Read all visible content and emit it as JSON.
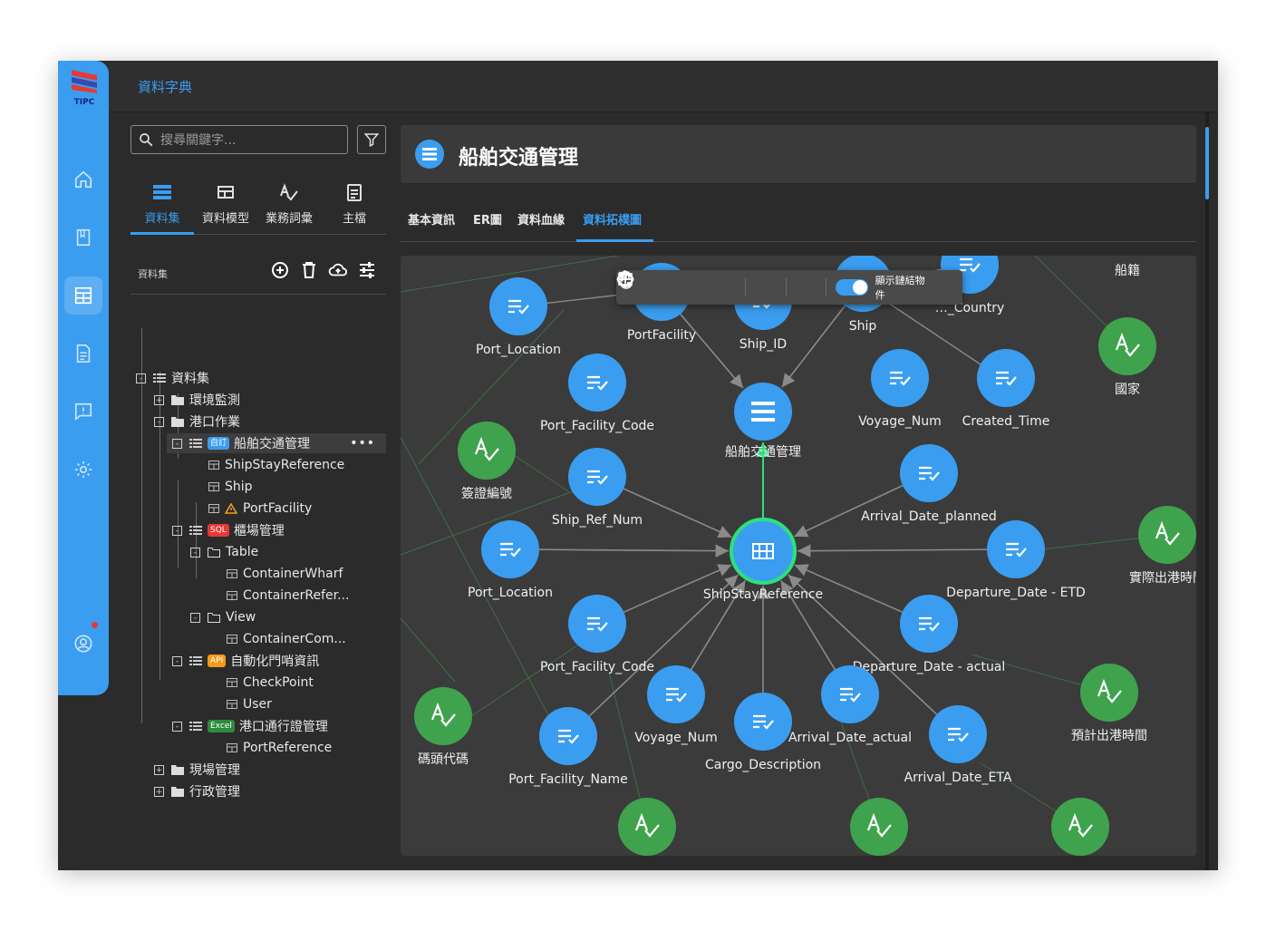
{
  "app": {
    "title": "資料字典",
    "logo_text": "TIPC",
    "brand_color": "#3a9df0"
  },
  "rail": {
    "items": [
      "home-icon",
      "book-icon",
      "dashboard-icon",
      "document-icon",
      "feedback-icon",
      "settings-icon"
    ],
    "user_icon": "user-icon"
  },
  "search": {
    "placeholder": "搜尋關鍵字..."
  },
  "left_tabs": [
    {
      "label": "資料集"
    },
    {
      "label": "資料模型"
    },
    {
      "label": "業務詞彙"
    },
    {
      "label": "主檔"
    }
  ],
  "section": {
    "label": "資料集"
  },
  "tree": {
    "root": "資料集",
    "env": "環境監測",
    "port": "港口作業",
    "ship_traffic": {
      "badge": "自訂",
      "label": "船舶交通管理",
      "more": "•••"
    },
    "ship_stay": "ShipStayReference",
    "ship": "Ship",
    "port_facility": "PortFacility",
    "yard": {
      "badge": "SQL",
      "label": "櫃場管理"
    },
    "table": "Table",
    "container_wharf": "ContainerWharf",
    "container_refer": "ContainerRefer...",
    "view": "View",
    "container_com": "ContainerCom...",
    "gate": {
      "badge": "API",
      "label": "自動化門哨資訊"
    },
    "checkpoint": "CheckPoint",
    "user": "User",
    "permit": {
      "badge": "Excel",
      "label": "港口通行證管理"
    },
    "port_reference": "PortReference",
    "site": "現場管理",
    "admin": "行政管理"
  },
  "header": {
    "title": "船舶交通管理"
  },
  "tabs": [
    {
      "label": "基本資訊"
    },
    {
      "label": "ER圖"
    },
    {
      "label": "資料血緣"
    },
    {
      "label": "資料拓樸圖"
    }
  ],
  "toolbar": {
    "toggle_label": "顯示鏈結物件"
  },
  "graph": {
    "center": "ShipStayReference",
    "dataset": "船舶交通管理",
    "labels": {
      "port_location_top": "Port_Location",
      "port_facility": "PortFacility",
      "ship_id": "Ship_ID",
      "ship": "Ship",
      "country": "Country",
      "nationality": "船籍",
      "country_term": "國家",
      "port_facility_code_top": "Port_Facility_Code",
      "voyage_num_top": "Voyage_Num",
      "created_time": "Created_Time",
      "visa_num": "簽證編號",
      "ship_ref_num": "Ship_Ref_Num",
      "arrival_planned": "Arrival_Date_planned",
      "port_location": "Port_Location",
      "departure_etd": "Departure_Date - ETD",
      "actual_departure_term": "實際出港時間",
      "port_facility_code": "Port_Facility_Code",
      "departure_actual": "Departure_Date - actual",
      "voyage_num": "Voyage_Num",
      "wharf_code": "碼頭代碼",
      "cargo_description": "Cargo_Description",
      "arrival_actual": "Arrival_Date_actual",
      "arrival_eta": "Arrival_Date_ETA",
      "planned_departure_term": "預計出港時間",
      "port_facility_name": "Port_Facility_Name"
    },
    "colors": {
      "field": "#3a9df0",
      "term": "#3fa34d",
      "center_ring": "#2ee07a"
    }
  }
}
